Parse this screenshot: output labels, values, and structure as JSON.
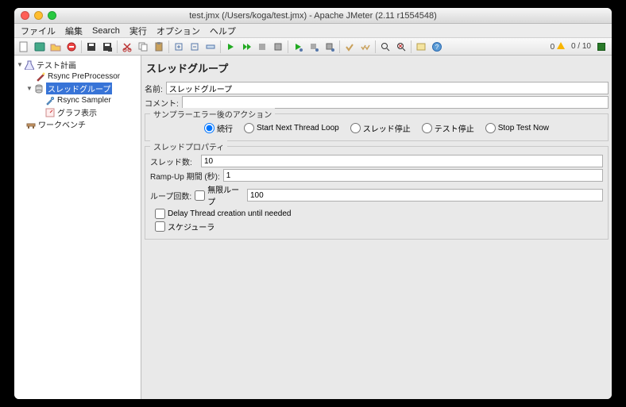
{
  "window": {
    "title": "test.jmx (/Users/koga/test.jmx) - Apache JMeter (2.11 r1554548)"
  },
  "menu": {
    "file": "ファイル",
    "edit": "編集",
    "search": "Search",
    "run": "実行",
    "options": "オプション",
    "help": "ヘルプ"
  },
  "status": {
    "warn_count": "0",
    "threads": "0 / 10"
  },
  "tree": {
    "test_plan": "テスト計画",
    "preproc": "Rsync PreProcessor",
    "thread_group": "スレッドグループ",
    "sampler": "Rsync Sampler",
    "graph": "グラフ表示",
    "workbench": "ワークベンチ"
  },
  "panel": {
    "title": "スレッドグループ",
    "name_label": "名前:",
    "name_value": "スレッドグループ",
    "comment_label": "コメント:",
    "comment_value": "",
    "error_group": "サンプラーエラー後のアクション",
    "radio_continue": "続行",
    "radio_next_loop": "Start Next Thread Loop",
    "radio_stop_thread": "スレッド停止",
    "radio_stop_test": "テスト停止",
    "radio_stop_now": "Stop Test Now",
    "props_group": "スレッドプロパティ",
    "threads_label": "スレッド数:",
    "threads_value": "10",
    "rampup_label": "Ramp-Up 期間 (秒):",
    "rampup_value": "1",
    "loop_label": "ループ回数:",
    "loop_forever": "無限ループ",
    "loop_value": "100",
    "delay_label": "Delay Thread creation until needed",
    "scheduler_label": "スケジューラ"
  }
}
